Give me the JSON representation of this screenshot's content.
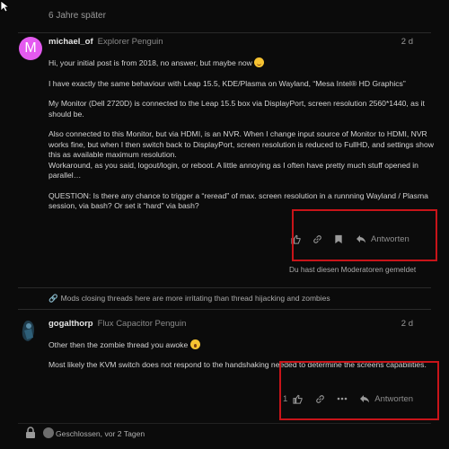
{
  "gap_label": "6 Jahre später",
  "post1": {
    "avatar_letter": "M",
    "username": "michael_of",
    "user_title": "Explorer Penguin",
    "date": "2 d",
    "para1": "Hi, your initial post is from 2018, no answer, but maybe now",
    "para2": "I have exactly the same behaviour with Leap 15.5, KDE/Plasma on Wayland, “Mesa Intel® HD Graphics”",
    "para3": "My Monitor (Dell 2720D) is connected to the Leap 15.5 box via DisplayPort, screen resolution 2560*1440, as it should be.",
    "para4": "Also connected to this Monitor, but via HDMI, is an NVR. When I change input source of Monitor to HDMI, NVR works fine, but when I then switch back to DisplayPort, screen resolution is reduced to FullHD, and settings show this as available maximum resolution.",
    "para5": "Workaround, as you said, logout/login, or reboot. A little annoying as I often have pretty much stuff opened in parallel…",
    "para6": "QUESTION: Is there any chance to trigger a “reread” of max. screen resolution in a runnning Wayland / Plasma session, via bash? Or set it “hard” via bash?",
    "reply_label": "Antworten",
    "hidden_note": "Du hast diesen Moderatoren gemeldet"
  },
  "link_note": "Mods closing threads here are more irritating than thread hijacking and zombies",
  "post2": {
    "username": "gogalthorp",
    "user_title": "Flux Capacitor Penguin",
    "date": "2 d",
    "para1": "Other then the zombie thread you awoke",
    "para2": "Most likely the KVM switch does not respond to the handshaking needed to determine the screens capabilities.",
    "like_count": "1",
    "reply_label": "Antworten"
  },
  "closed_text": "Geschlossen, vor 2 Tagen",
  "colors": {
    "background": "#0b0b0b",
    "highlight_box": "#c81419",
    "avatar_m": "#e45af0"
  }
}
